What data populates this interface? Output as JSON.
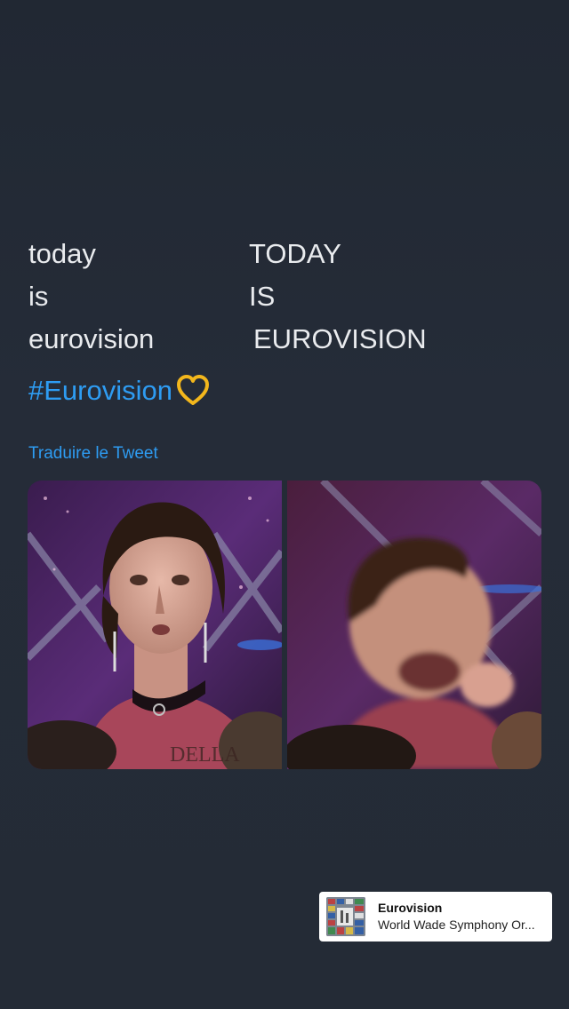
{
  "tweet": {
    "lines": [
      {
        "left": "today",
        "right": "TODAY"
      },
      {
        "left": "is",
        "right": "IS"
      },
      {
        "left": "eurovision",
        "right": "EUROVISION"
      }
    ],
    "hashtag": "#Eurovision",
    "translate_label": "Traduire le Tweet",
    "media": [
      {
        "caption": "DELLA"
      },
      {
        "caption": ""
      }
    ]
  },
  "music": {
    "title": "Eurovision",
    "artist": "World Wade Symphony Or..."
  },
  "colors": {
    "background": "#242b36",
    "text": "#e9ebee",
    "link": "#2e9cf2",
    "heart": "#f3b71c"
  }
}
